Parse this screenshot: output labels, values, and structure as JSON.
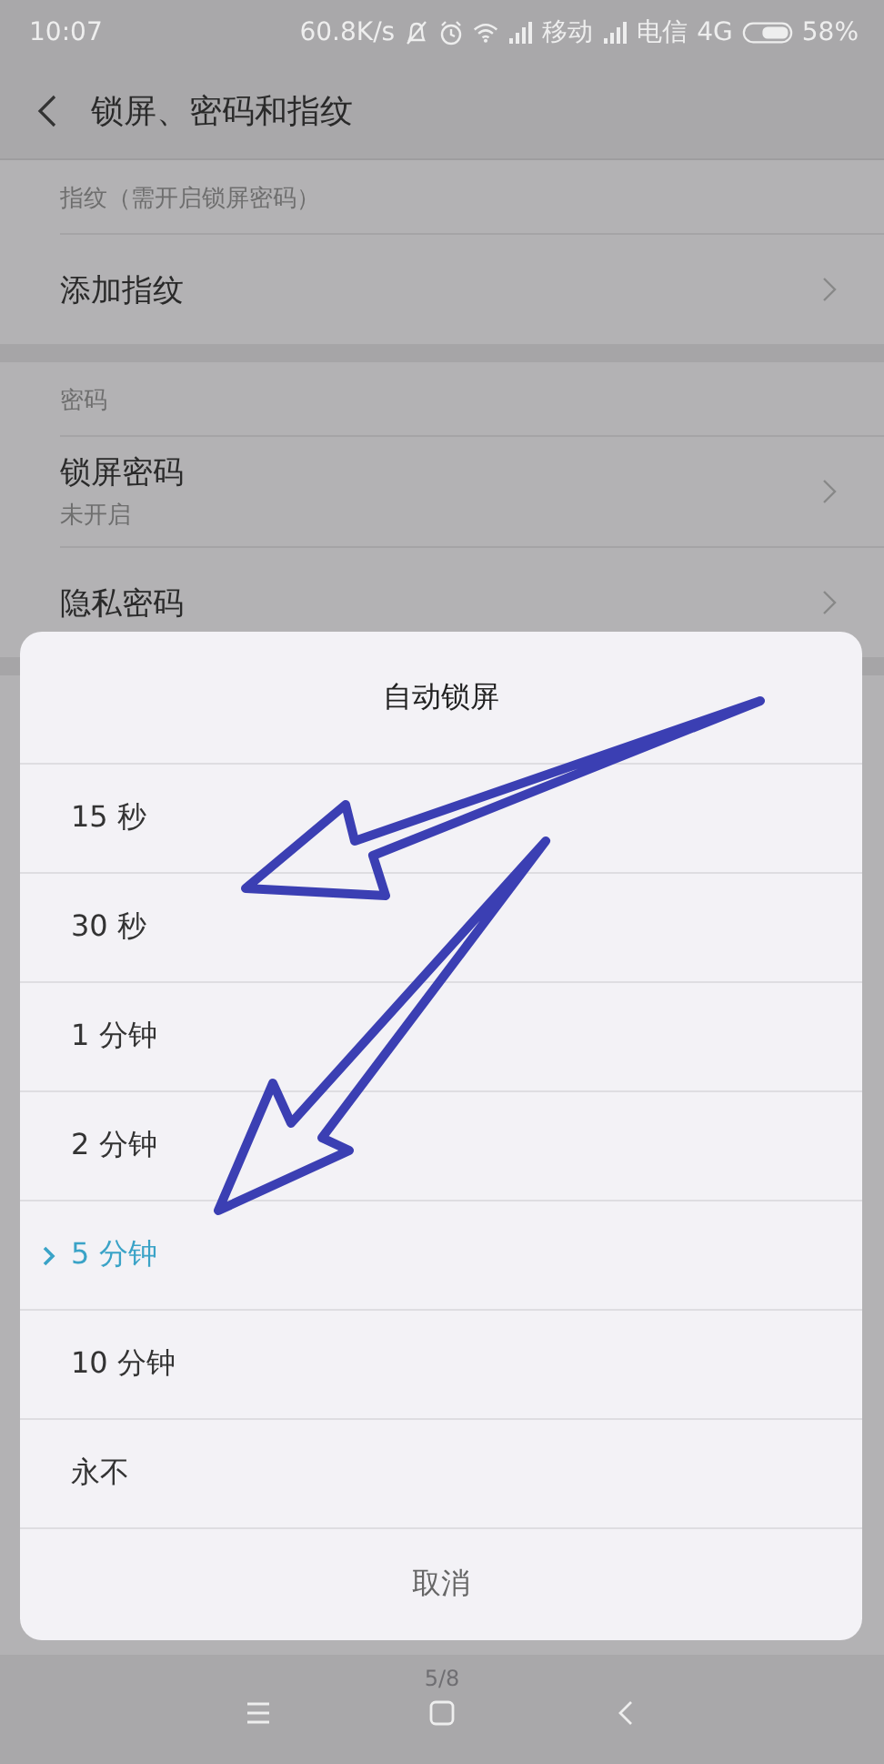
{
  "status_bar": {
    "time": "10:07",
    "net_speed": "60.8K/s",
    "carrier_1": "移动",
    "carrier_2": "电信",
    "network": "4G",
    "battery": "58%"
  },
  "header": {
    "title": "锁屏、密码和指纹"
  },
  "sections": [
    {
      "label": "指纹（需开启锁屏密码）",
      "rows": [
        {
          "title": "添加指纹"
        }
      ]
    },
    {
      "label": "密码",
      "rows": [
        {
          "title": "锁屏密码",
          "subtitle": "未开启"
        },
        {
          "title": "隐私密码"
        }
      ]
    }
  ],
  "dialog": {
    "title": "自动锁屏",
    "options": [
      {
        "label": "15 秒",
        "selected": false
      },
      {
        "label": "30 秒",
        "selected": false
      },
      {
        "label": "1 分钟",
        "selected": false
      },
      {
        "label": "2 分钟",
        "selected": false
      },
      {
        "label": "5 分钟",
        "selected": true
      },
      {
        "label": "10 分钟",
        "selected": false
      },
      {
        "label": "永不",
        "selected": false
      }
    ],
    "cancel": "取消"
  },
  "page_indicator": "5/8"
}
